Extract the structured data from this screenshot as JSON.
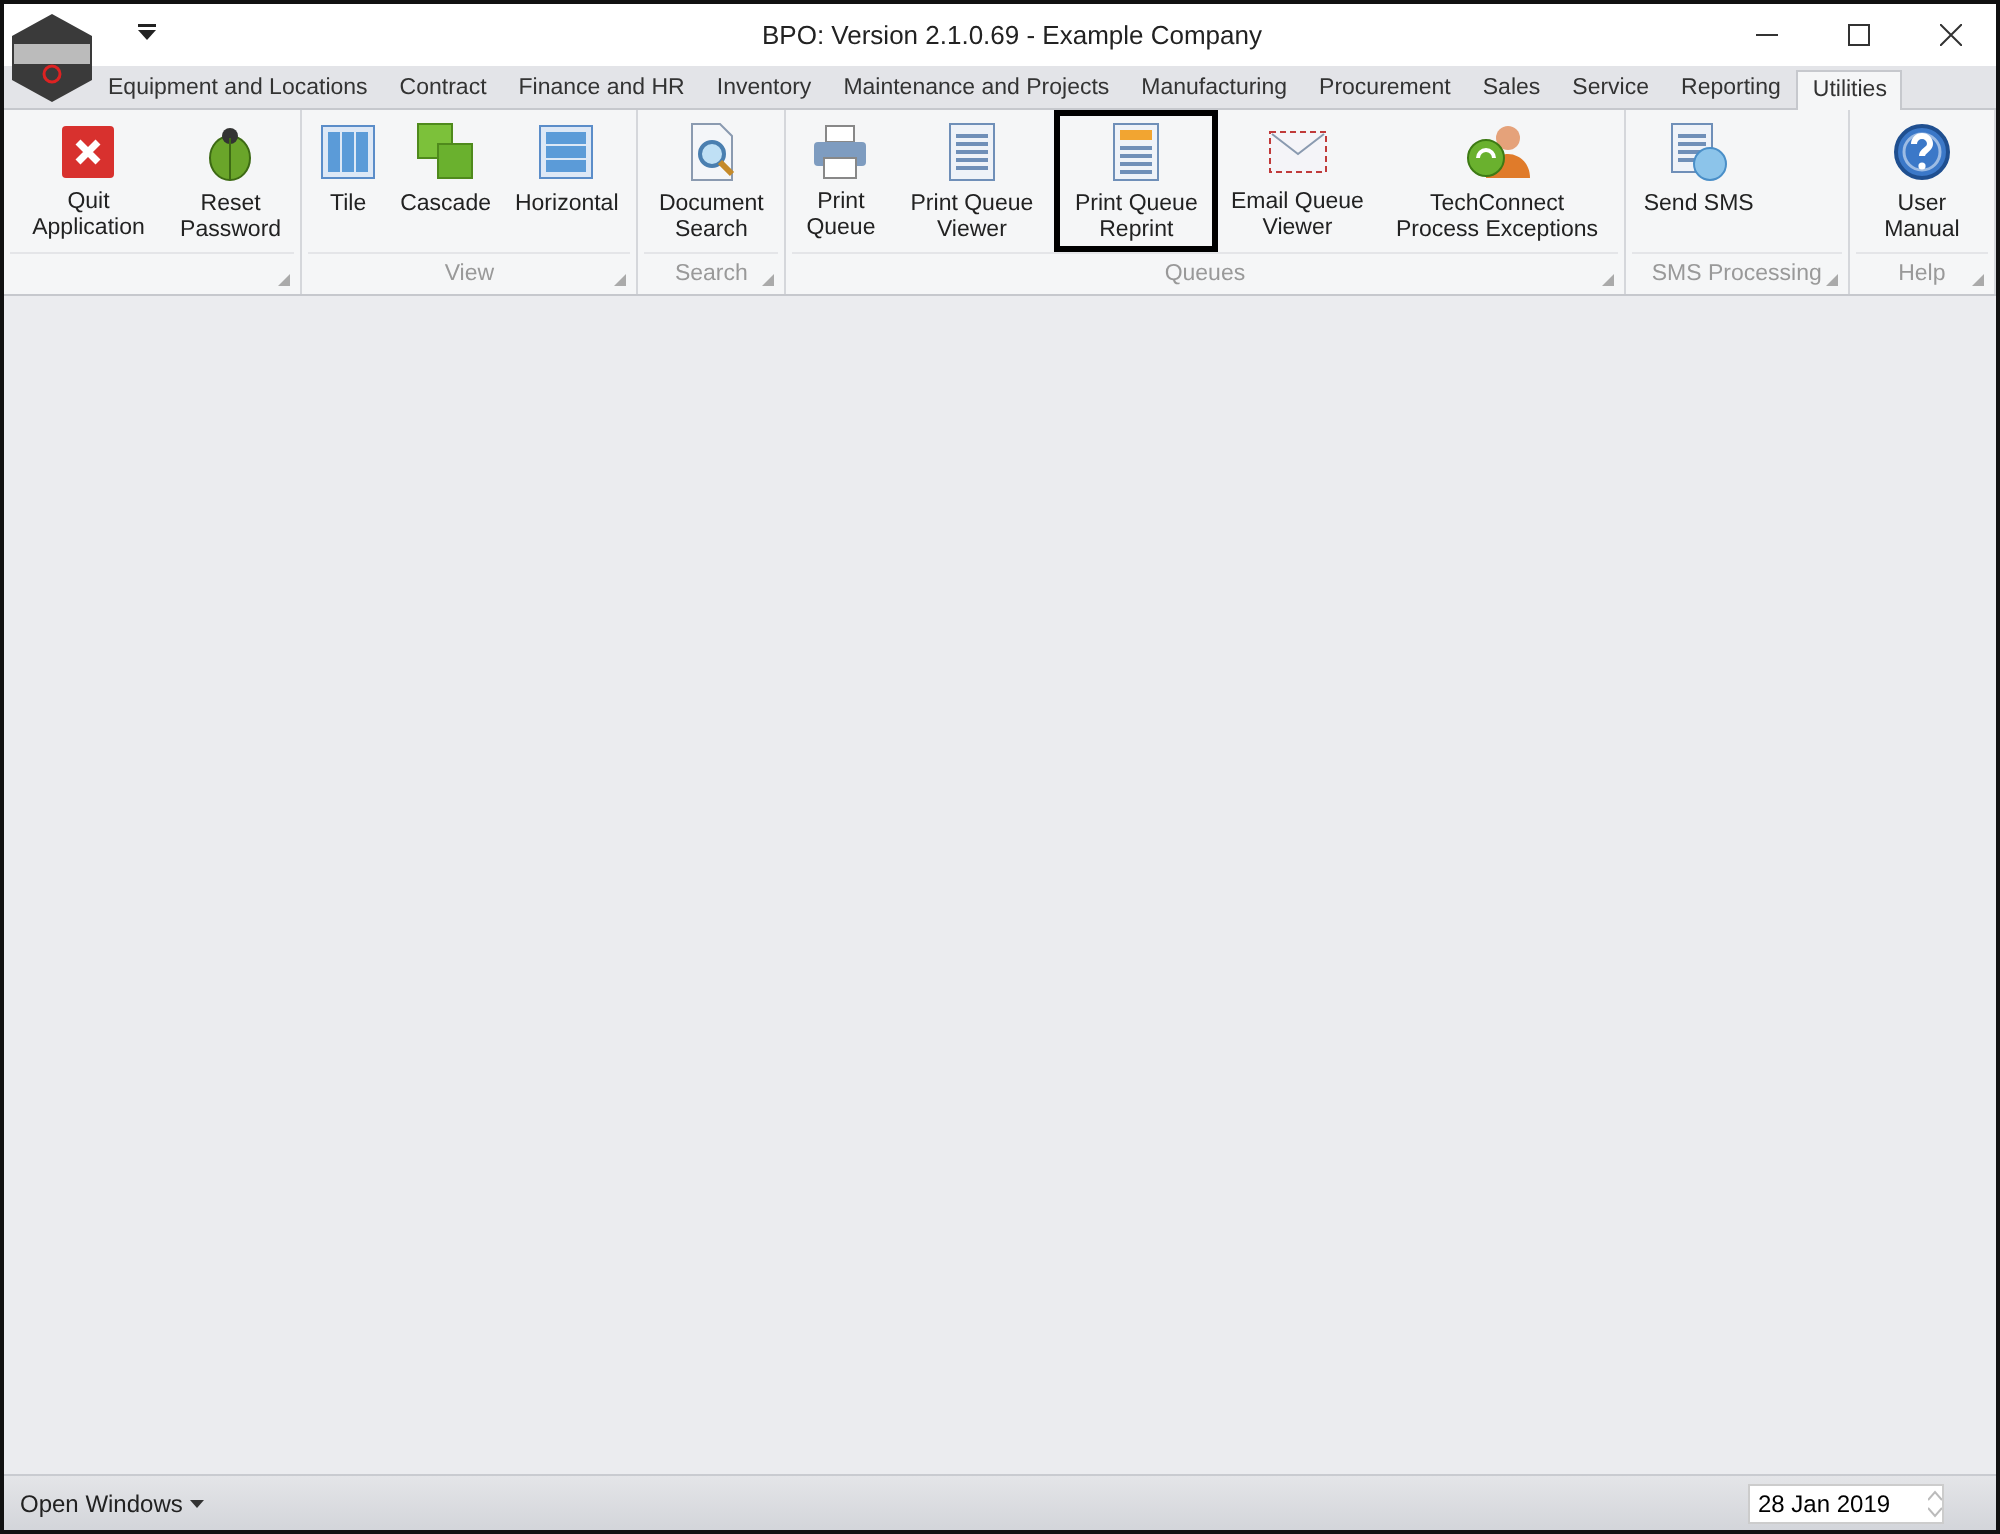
{
  "window": {
    "title": "BPO: Version 2.1.0.69 - Example Company"
  },
  "tabs": [
    {
      "label": "Equipment and Locations",
      "selected": false
    },
    {
      "label": "Contract",
      "selected": false
    },
    {
      "label": "Finance and HR",
      "selected": false
    },
    {
      "label": "Inventory",
      "selected": false
    },
    {
      "label": "Maintenance and Projects",
      "selected": false
    },
    {
      "label": "Manufacturing",
      "selected": false
    },
    {
      "label": "Procurement",
      "selected": false
    },
    {
      "label": "Sales",
      "selected": false
    },
    {
      "label": "Service",
      "selected": false
    },
    {
      "label": "Reporting",
      "selected": false
    },
    {
      "label": "Utilities",
      "selected": true
    }
  ],
  "ribbon_groups": [
    {
      "buttons": [
        {
          "label": "Quit Application",
          "highlighted": false
        },
        {
          "label": "Reset Password",
          "highlighted": false
        }
      ]
    },
    {
      "label": "View",
      "buttons": [
        {
          "label": "Tile",
          "highlighted": false
        },
        {
          "label": "Cascade",
          "highlighted": false
        },
        {
          "label": "Horizontal",
          "highlighted": false
        }
      ]
    },
    {
      "label": "Search",
      "buttons": [
        {
          "label": "Document Search",
          "highlighted": false
        }
      ]
    },
    {
      "label": "Queues",
      "buttons": [
        {
          "label": "Print Queue",
          "highlighted": false
        },
        {
          "label": "Print Queue Viewer",
          "highlighted": false
        },
        {
          "label": "Print Queue Reprint",
          "highlighted": true
        },
        {
          "label": "Email Queue Viewer",
          "highlighted": false
        },
        {
          "label": "TechConnect Process Exceptions",
          "highlighted": false
        }
      ]
    },
    {
      "label": "SMS Processing",
      "buttons": [
        {
          "label": "Send SMS",
          "highlighted": false
        }
      ]
    },
    {
      "label": "Help",
      "buttons": [
        {
          "label": "User Manual",
          "highlighted": false
        }
      ]
    }
  ],
  "status_bar": {
    "open_windows": "Open Windows",
    "date": "28 Jan 2019"
  }
}
